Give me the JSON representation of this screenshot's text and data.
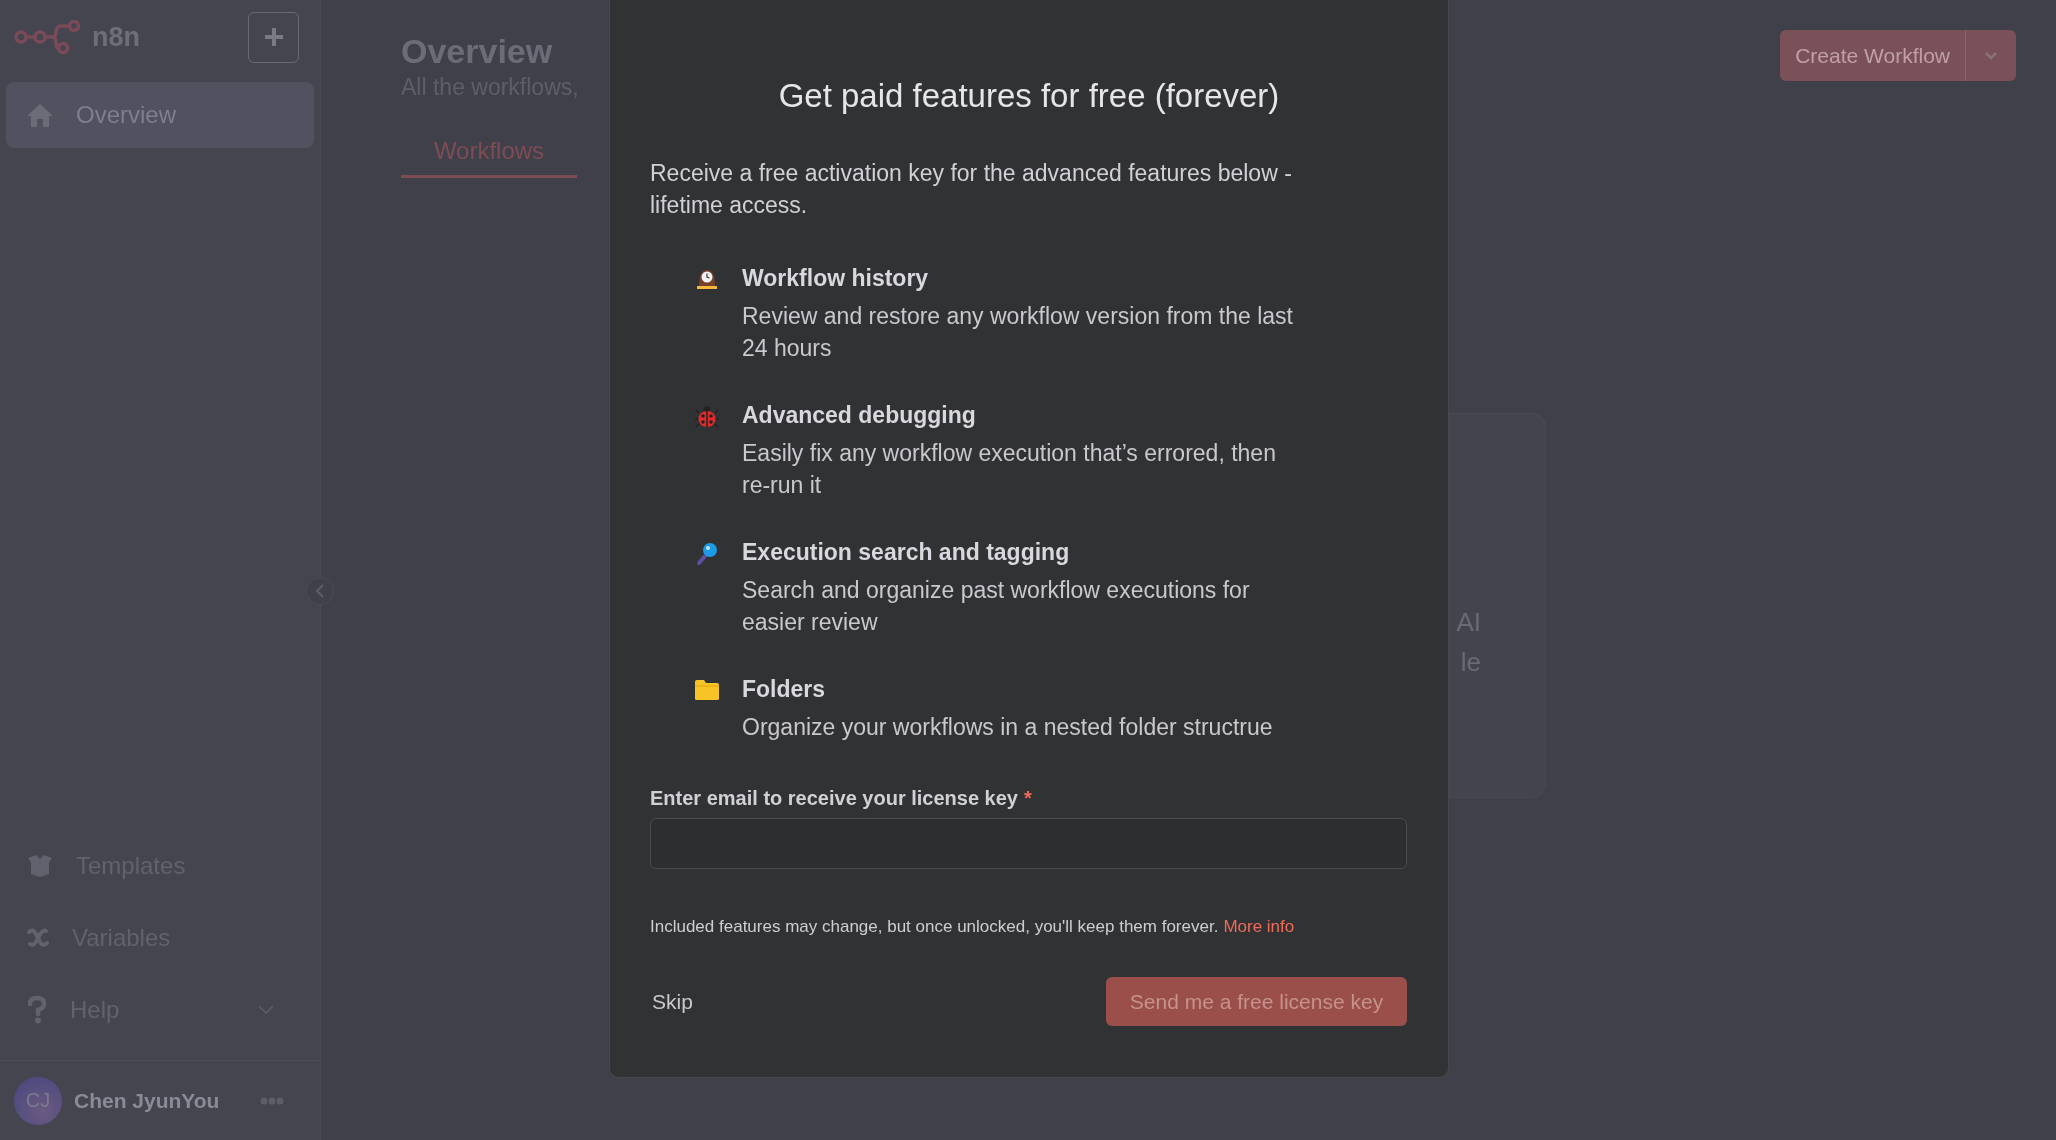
{
  "sidebar": {
    "logo": "n8n",
    "nav": [
      {
        "label": "Overview",
        "kind": "home",
        "selected": true
      }
    ],
    "bottom_nav": [
      {
        "label": "Templates",
        "kind": "templates"
      },
      {
        "label": "Variables",
        "kind": "variables"
      },
      {
        "label": "Help",
        "kind": "help",
        "expanded": false
      }
    ],
    "user": {
      "initials": "CJ",
      "name": "Chen JyunYou"
    }
  },
  "header": {
    "title": "Overview",
    "subtitle": "All the workflows,",
    "primary_button": "Create Workflow"
  },
  "tabs": [
    {
      "label": "Workflows",
      "selected": true
    }
  ],
  "card_fragment": {
    "lines": [
      "AI",
      "le"
    ]
  },
  "modal": {
    "title": "Get paid features for free (forever)",
    "intro": "Receive a free activation key for the advanced features below - lifetime access.",
    "features": [
      {
        "kind": "history",
        "title": "Workflow history",
        "description": "Review and restore any workflow version from the last 24 hours"
      },
      {
        "kind": "debugging",
        "title": "Advanced debugging",
        "description": "Easily fix any workflow execution that’s errored, then re-run it"
      },
      {
        "kind": "search",
        "title": "Execution search and tagging",
        "description": "Search and organize past workflow executions for easier review"
      },
      {
        "kind": "folders",
        "title": "Folders",
        "description": "Organize your workflows in a nested folder structrue"
      }
    ],
    "email_field": {
      "label": "Enter email to receive your license key",
      "required_mark": "*"
    },
    "note": "Included features may change, but once unlocked, you'll keep them forever.",
    "note_link": "More info",
    "skip": "Skip",
    "submit": "Send me a free license key"
  }
}
